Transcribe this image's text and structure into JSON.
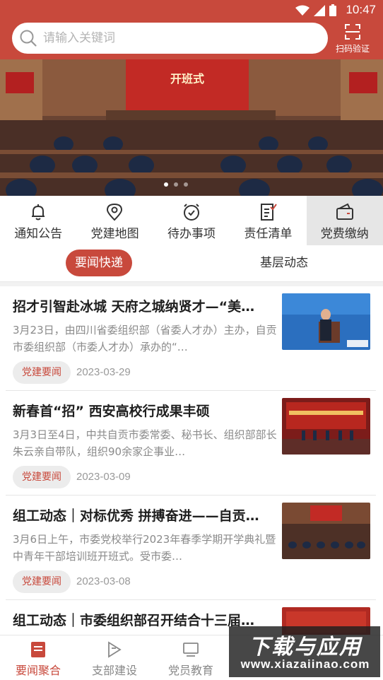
{
  "status_bar": {
    "time": "10:47"
  },
  "search": {
    "placeholder": "请输入关键词"
  },
  "scan": {
    "label": "扫码验证"
  },
  "banner": {
    "title": "开班式",
    "slides": 3,
    "active_slide": 1
  },
  "quick_nav": [
    {
      "label": "通知公告",
      "icon": "bell-icon"
    },
    {
      "label": "党建地图",
      "icon": "map-pin-icon"
    },
    {
      "label": "待办事项",
      "icon": "alarm-clock-icon"
    },
    {
      "label": "责任清单",
      "icon": "checklist-icon"
    },
    {
      "label": "党费缴纳",
      "icon": "wallet-icon",
      "active": true
    }
  ],
  "tabs": [
    {
      "label": "要闻快递",
      "active": true
    },
    {
      "label": "基层动态"
    }
  ],
  "news": [
    {
      "title": "招才引智赴冰城 天府之城纳贤才—“美…",
      "desc": "3月23日，由四川省委组织部（省委人才办）主办，自贡市委组织部（市委人才办）承办的“…",
      "tag": "党建要闻",
      "date": "2023-03-29"
    },
    {
      "title": "新春首“招” 西安高校行成果丰硕",
      "desc": "3月3日至4日，中共自贡市委常委、秘书长、组织部部长朱云亲自带队，组织90余家企事业…",
      "tag": "党建要闻",
      "date": "2023-03-09"
    },
    {
      "title": "组工动态｜对标优秀 拼搏奋进——自贡…",
      "desc": "3月6日上午，市委党校举行2023年春季学期开学典礼暨中青年干部培训班开班式。受市委…",
      "tag": "党建要闻",
      "date": "2023-03-08"
    },
    {
      "title": "组工动态｜市委组织部召开结合十三届…",
      "desc": "",
      "tag": "",
      "date": ""
    }
  ],
  "bottom_nav": [
    {
      "label": "要闻聚合",
      "icon": "news-icon",
      "active": true
    },
    {
      "label": "支部建设",
      "icon": "flag-icon"
    },
    {
      "label": "党员教育",
      "icon": "monitor-icon"
    }
  ],
  "watermark": {
    "big": "下载与应用",
    "small": "www.xiazaiinao.com"
  },
  "colors": {
    "brand_red": "#c8493c"
  }
}
